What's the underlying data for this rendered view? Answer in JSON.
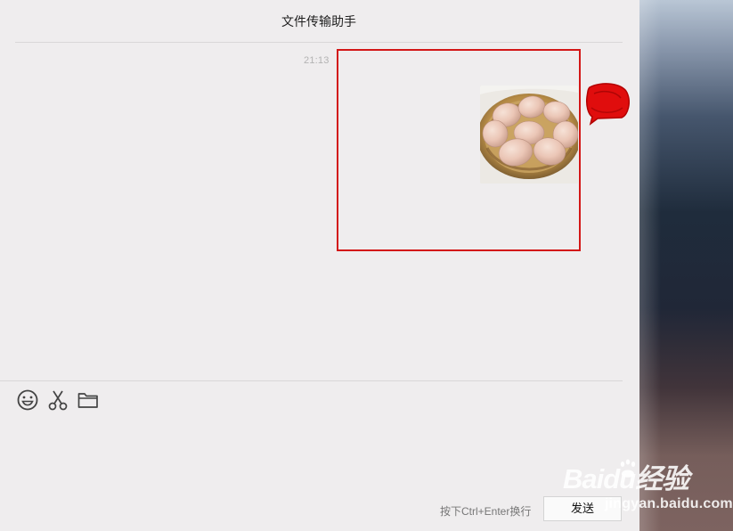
{
  "chat": {
    "title": "文件传输助手",
    "time": "21:13"
  },
  "toolbar": {
    "icons": [
      "smiley-icon",
      "scissors-icon",
      "folder-icon"
    ]
  },
  "composer": {
    "hint": "按下Ctrl+Enter换行",
    "send_label": "发送"
  },
  "watermark": {
    "brand": "Baidu经验",
    "site": "jingyan.baidu.com"
  },
  "colors": {
    "background": "#efedee",
    "annotation": "#d31717",
    "divider": "#d9d7d8"
  }
}
